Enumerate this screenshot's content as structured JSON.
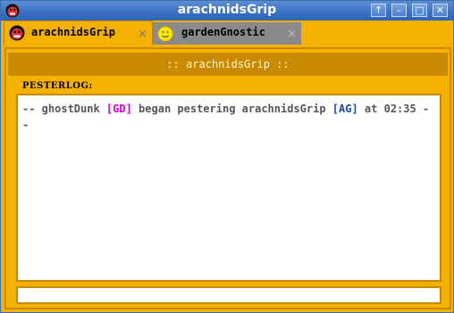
{
  "window": {
    "title": "arachnidsGrip",
    "controls": [
      "up",
      "minimize",
      "maximize",
      "close"
    ]
  },
  "tabs": [
    {
      "label": "arachnidsGrip",
      "icon": "angry-face-icon",
      "active": true
    },
    {
      "label": "gardenGnostic",
      "icon": "smiley-face-icon",
      "active": false
    }
  ],
  "chat": {
    "header": ":: arachnidsGrip ::",
    "log_label": "PESTERLOG:",
    "log": {
      "prefix": "-- ghostDunk ",
      "handle1": "[GD]",
      "middle": " began pestering arachnidsGrip ",
      "handle2": "[AG]",
      "suffix": " at 02:35 --"
    },
    "input_value": ""
  },
  "colors": {
    "accent": "#f4b100",
    "header_bar": "#c98900",
    "handle_gd": "#d400d4",
    "handle_ag": "#1a4a9e",
    "inactive_tab": "#8a8a8a"
  }
}
